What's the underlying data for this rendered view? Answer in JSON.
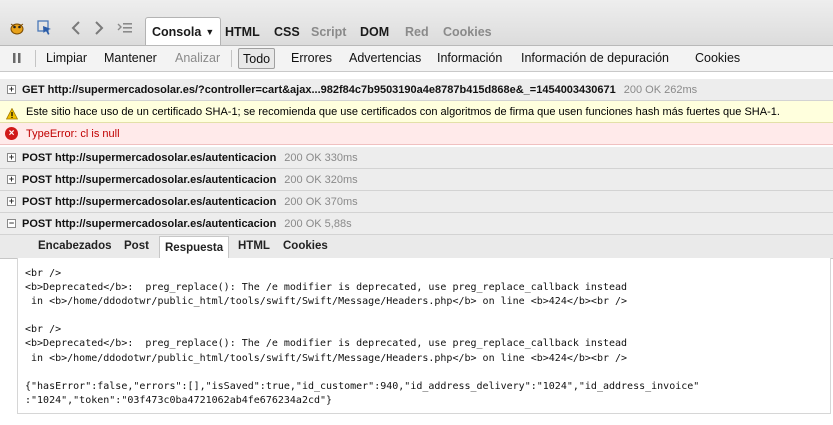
{
  "toolbar": {
    "tabs": [
      {
        "label": "Consola",
        "active": true
      },
      {
        "label": "HTML",
        "disabled": false
      },
      {
        "label": "CSS",
        "disabled": false
      },
      {
        "label": "Script",
        "disabled": true
      },
      {
        "label": "DOM",
        "disabled": false
      },
      {
        "label": "Red",
        "disabled": true
      },
      {
        "label": "Cookies",
        "disabled": true
      }
    ]
  },
  "filterbar": {
    "clear": "Limpiar",
    "persist": "Mantener",
    "profile": "Analizar",
    "levels": [
      "Todo",
      "Errores",
      "Advertencias",
      "Información",
      "Información de depuración",
      "Cookies"
    ]
  },
  "console": {
    "get_row": {
      "method": "GET http://supermercadosolar.es/?controller=cart&ajax...982f84c7b9503190a4e8787b415d868e&_=1454003430671",
      "status": "200 OK 262ms"
    },
    "warning": "Este sitio hace uso de un certificado SHA-1; se recomienda que use certificados con algoritmos de firma que usen funciones hash más fuertes que SHA-1.",
    "error": "TypeError: cl is null",
    "post_rows": [
      {
        "method": "POST http://supermercadosolar.es/autenticacion",
        "status": "200 OK 330ms"
      },
      {
        "method": "POST http://supermercadosolar.es/autenticacion",
        "status": "200 OK 320ms"
      },
      {
        "method": "POST http://supermercadosolar.es/autenticacion",
        "status": "200 OK 370ms"
      },
      {
        "method": "POST http://supermercadosolar.es/autenticacion",
        "status": "200 OK 5,88s"
      }
    ]
  },
  "response": {
    "tabs": [
      "Encabezados",
      "Post",
      "Respuesta",
      "HTML",
      "Cookies"
    ],
    "active_tab": "Respuesta",
    "body": "<br />\n<b>Deprecated</b>:  preg_replace(): The /e modifier is deprecated, use preg_replace_callback instead\n in <b>/home/ddodotwr/public_html/tools/swift/Swift/Message/Headers.php</b> on line <b>424</b><br />\n\n<br />\n<b>Deprecated</b>:  preg_replace(): The /e modifier is deprecated, use preg_replace_callback instead\n in <b>/home/ddodotwr/public_html/tools/swift/Swift/Message/Headers.php</b> on line <b>424</b><br />\n\n{\"hasError\":false,\"errors\":[],\"isSaved\":true,\"id_customer\":940,\"id_address_delivery\":\"1024\",\"id_address_invoice\"\n:\"1024\",\"token\":\"03f473c0ba4721062ab4fe676234a2cd\"}"
  }
}
